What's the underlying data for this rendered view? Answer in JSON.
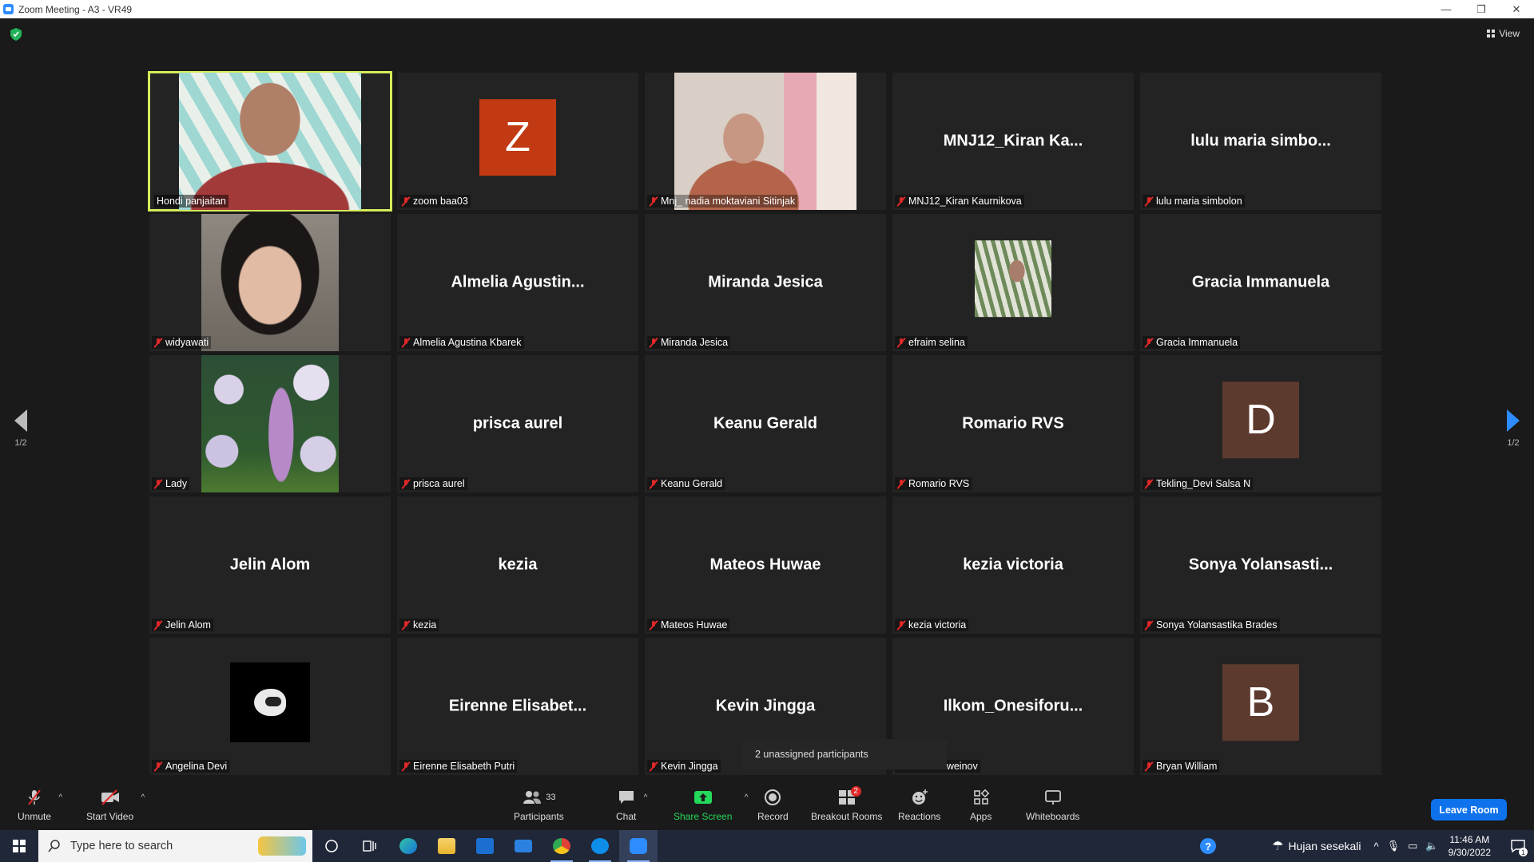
{
  "window": {
    "title": "Zoom Meeting - A3 - VR49",
    "minimize": "—",
    "maximize": "❐",
    "close": "✕"
  },
  "view_label": "View",
  "page_indicator": "1/2",
  "participants": [
    {
      "label": "Hondi panjaitan",
      "type": "video",
      "video": "v-hondi",
      "muted": false,
      "active": true
    },
    {
      "label": "zoom baa03",
      "type": "avatar",
      "letter": "Z",
      "color": "#c23a13",
      "muted": true
    },
    {
      "label": "Mnj_ nadia moktaviani Sitinjak",
      "type": "video",
      "video": "v-nadia",
      "muted": true
    },
    {
      "label": "MNJ12_Kiran Kaurnikova",
      "type": "name",
      "display": "MNJ12_Kiran  Ka...",
      "muted": true
    },
    {
      "label": "lulu maria simbolon",
      "type": "name",
      "display": "lulu  maria  simbo...",
      "muted": true
    },
    {
      "label": "widyawati",
      "type": "video",
      "video": "v-widya",
      "muted": true
    },
    {
      "label": "Almelia Agustina Kbarek",
      "type": "name",
      "display": "Almelia  Agustin...",
      "muted": true
    },
    {
      "label": "Miranda Jesica",
      "type": "name",
      "display": "Miranda Jesica",
      "muted": true
    },
    {
      "label": "efraim selina",
      "type": "thumb",
      "video": "v-efraim",
      "muted": true
    },
    {
      "label": "Gracia Immanuela",
      "type": "name",
      "display": "Gracia Immanuela",
      "muted": true
    },
    {
      "label": "Lady",
      "type": "video",
      "video": "v-lady",
      "muted": true
    },
    {
      "label": "prisca aurel",
      "type": "name",
      "display": "prisca aurel",
      "muted": true
    },
    {
      "label": "Keanu Gerald",
      "type": "name",
      "display": "Keanu Gerald",
      "muted": true
    },
    {
      "label": "Romario RVS",
      "type": "name",
      "display": "Romario RVS",
      "muted": true
    },
    {
      "label": "Tekling_Devi Salsa N",
      "type": "avatar",
      "letter": "D",
      "color": "#5c3a2e",
      "muted": true
    },
    {
      "label": "Jelin Alom",
      "type": "name",
      "display": "Jelin Alom",
      "muted": true
    },
    {
      "label": "kezia",
      "type": "name",
      "display": "kezia",
      "muted": true
    },
    {
      "label": "Mateos Huwae",
      "type": "name",
      "display": "Mateos Huwae",
      "muted": true
    },
    {
      "label": "kezia victoria",
      "type": "name",
      "display": "kezia victoria",
      "muted": true
    },
    {
      "label": "Sonya Yolansastika Brades",
      "type": "name",
      "display": "Sonya  Yolansasti...",
      "muted": true
    },
    {
      "label": "Angelina Devi",
      "type": "thumb",
      "video": "v-helmet",
      "muted": true
    },
    {
      "label": "Eirenne Elisabeth Putri",
      "type": "name",
      "display": "Eirenne  Elisabet...",
      "muted": true
    },
    {
      "label": "Kevin Jingga",
      "type": "name",
      "display": "Kevin Jingga",
      "muted": true
    },
    {
      "label": "nesiforus Zweinov",
      "type": "name",
      "display": "Ilkom_Onesiforu...",
      "muted": false
    },
    {
      "label": "Bryan William",
      "type": "avatar",
      "letter": "B",
      "color": "#5c3a2e",
      "muted": true
    }
  ],
  "tooltip": "2 unassigned participants",
  "controls": {
    "unmute": "Unmute",
    "start_video": "Start Video",
    "participants": "Participants",
    "participants_count": "33",
    "chat": "Chat",
    "share_screen": "Share Screen",
    "record": "Record",
    "breakout_rooms": "Breakout Rooms",
    "breakout_badge": "2",
    "reactions": "Reactions",
    "apps": "Apps",
    "whiteboards": "Whiteboards",
    "leave": "Leave Room"
  },
  "taskbar": {
    "search_placeholder": "Type here to search",
    "weather": "Hujan sesekali",
    "time": "11:46 AM",
    "date": "9/30/2022",
    "notif_count": "1"
  },
  "colors": {
    "accent": "#2d8cff",
    "active_speaker": "#d6ec5a",
    "share_green": "#23d959",
    "leave_blue": "#0e72ed",
    "muted_red": "#e02828"
  }
}
